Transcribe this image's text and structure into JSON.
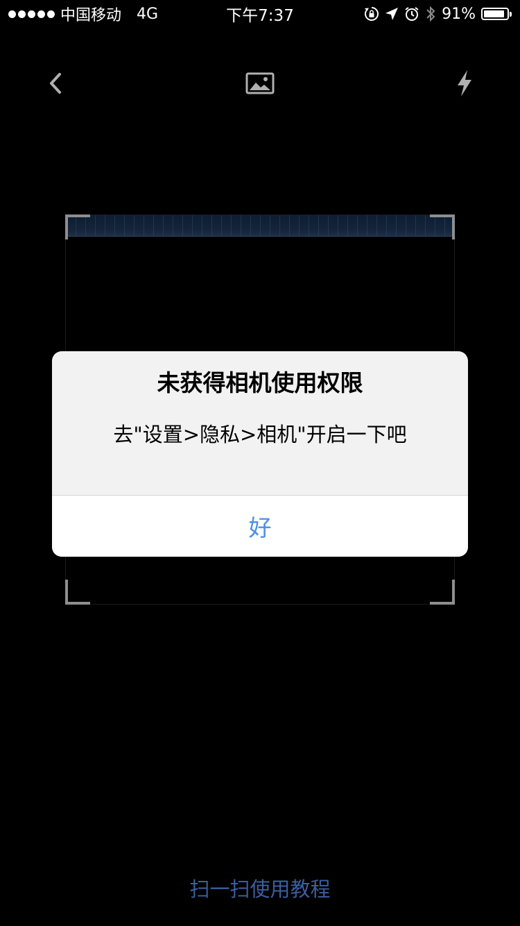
{
  "status_bar": {
    "carrier": "中国移动",
    "network": "4G",
    "time": "下午7:37",
    "battery_percent": "91%",
    "battery_level": 0.91,
    "icons": [
      "signal-dots-icon",
      "rotation-lock-icon",
      "location-arrow-icon",
      "alarm-icon",
      "bluetooth-icon",
      "battery-icon"
    ]
  },
  "toolbar": {
    "back_icon": "chevron-left-icon",
    "gallery_icon": "image-icon",
    "flash_icon": "lightning-bolt-icon"
  },
  "alert": {
    "title": "未获得相机使用权限",
    "message": "去\"设置>隐私>相机\"开启一下吧",
    "button_label": "好",
    "button_color": "#4a90e2"
  },
  "footer": {
    "tutorial_label": "扫一扫使用教程",
    "link_color": "#3b5fa0"
  }
}
